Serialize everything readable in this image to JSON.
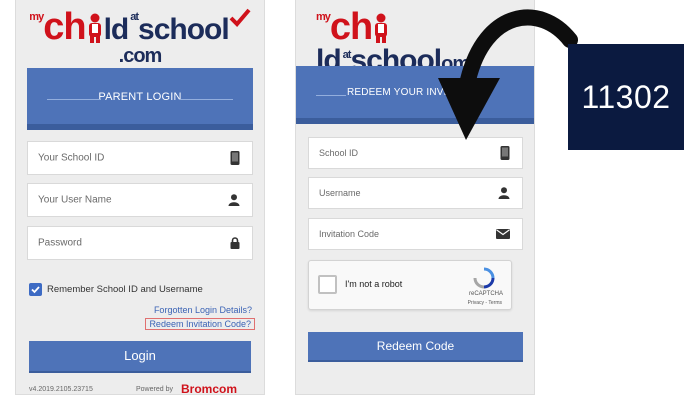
{
  "left": {
    "logo": {
      "my": "my",
      "ch": "ch",
      "ld": "ld",
      "at": "at",
      "school": "school",
      "dotcom": ".com"
    },
    "banner_title": "PARENT LOGIN",
    "fields": [
      {
        "placeholder": "Your School ID",
        "icon": "tablet-icon"
      },
      {
        "placeholder": "Your User Name",
        "icon": "user-icon"
      },
      {
        "placeholder": "Password",
        "icon": "lock-icon"
      }
    ],
    "remember_label": "Remember School ID and Username",
    "forgot_link": "Forgotten Login Details?",
    "redeem_link": "Redeem Invitation Code?",
    "login_button": "Login",
    "footer_left": "v4.2019.2105.23715",
    "footer_powered": "Powered by",
    "footer_brand": "Bromcom"
  },
  "right": {
    "logo": {
      "my": "my",
      "ch": "ch",
      "ld": "ld",
      "at": "at",
      "school": "school",
      "dotcom": "om"
    },
    "banner_title": "REDEEM YOUR INVITATION",
    "fields": [
      {
        "placeholder": "School ID",
        "icon": "tablet-icon"
      },
      {
        "placeholder": "Username",
        "icon": "user-icon"
      },
      {
        "placeholder": "Invitation Code",
        "icon": "envelope-icon"
      }
    ],
    "captcha": {
      "label": "I'm not a robot",
      "brand": "reCAPTCHA",
      "terms": "Privacy - Terms"
    },
    "redeem_button": "Redeem Code"
  },
  "badge": "11302",
  "colors": {
    "brand_blue": "#4e73b8",
    "brand_red": "#d0121b",
    "navy": "#0b1a40"
  }
}
